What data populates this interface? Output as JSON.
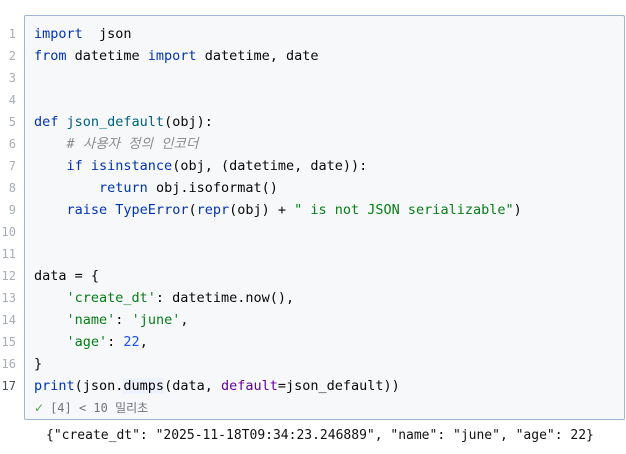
{
  "lines": [
    {
      "n": "1",
      "tokens": [
        [
          "kw",
          "import"
        ],
        [
          "",
          "  json"
        ]
      ]
    },
    {
      "n": "2",
      "tokens": [
        [
          "kw",
          "from"
        ],
        [
          "",
          " datetime "
        ],
        [
          "kw",
          "import"
        ],
        [
          "",
          " datetime, date"
        ]
      ]
    },
    {
      "n": "3",
      "tokens": []
    },
    {
      "n": "4",
      "tokens": []
    },
    {
      "n": "5",
      "tokens": [
        [
          "kw",
          "def "
        ],
        [
          "fn",
          "json_default"
        ],
        [
          "",
          "(obj):"
        ]
      ]
    },
    {
      "n": "6",
      "tokens": [
        [
          "",
          "    "
        ],
        [
          "cmt",
          "# 사용자 정의 인코더"
        ]
      ]
    },
    {
      "n": "7",
      "tokens": [
        [
          "",
          "    "
        ],
        [
          "kw",
          "if "
        ],
        [
          "kw",
          "isinstance"
        ],
        [
          "",
          "(obj, (datetime, date)):"
        ]
      ]
    },
    {
      "n": "8",
      "tokens": [
        [
          "",
          "        "
        ],
        [
          "kw",
          "return"
        ],
        [
          "",
          " obj.isoformat()"
        ]
      ]
    },
    {
      "n": "9",
      "tokens": [
        [
          "",
          "    "
        ],
        [
          "kw",
          "raise "
        ],
        [
          "kw",
          "TypeError"
        ],
        [
          "",
          "("
        ],
        [
          "kw",
          "repr"
        ],
        [
          "",
          "(obj) + "
        ],
        [
          "str",
          "\" is not JSON serializable\""
        ],
        [
          "",
          ")"
        ]
      ]
    },
    {
      "n": "10",
      "tokens": []
    },
    {
      "n": "11",
      "tokens": []
    },
    {
      "n": "12",
      "tokens": [
        [
          "",
          "data = {"
        ]
      ]
    },
    {
      "n": "13",
      "tokens": [
        [
          "",
          "    "
        ],
        [
          "str",
          "'create_dt'"
        ],
        [
          "",
          ": datetime.now(),"
        ]
      ]
    },
    {
      "n": "14",
      "tokens": [
        [
          "",
          "    "
        ],
        [
          "str",
          "'name'"
        ],
        [
          "",
          ": "
        ],
        [
          "str",
          "'june'"
        ],
        [
          "",
          ","
        ]
      ]
    },
    {
      "n": "15",
      "tokens": [
        [
          "",
          "    "
        ],
        [
          "str",
          "'age'"
        ],
        [
          "",
          ": "
        ],
        [
          "num",
          "22"
        ],
        [
          "",
          ","
        ]
      ]
    },
    {
      "n": "16",
      "tokens": [
        [
          "",
          "}"
        ]
      ]
    },
    {
      "n": "17",
      "tokens": [
        [
          "kw",
          "print"
        ],
        [
          "",
          "(json."
        ],
        [
          "hl",
          "dumps"
        ],
        [
          "",
          "(data, "
        ],
        [
          "kwarg",
          "default"
        ],
        [
          "",
          "=json_default))"
        ]
      ]
    }
  ],
  "status": {
    "check_icon": "check-icon",
    "text": "[4] < 10 밀리초"
  },
  "output": "{\"create_dt\": \"2025-11-18T09:34:23.246889\", \"name\": \"june\", \"age\": 22}"
}
